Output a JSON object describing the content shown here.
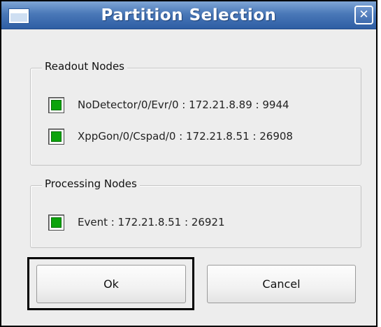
{
  "window": {
    "title": "Partition Selection",
    "close_label": "✕"
  },
  "readout_group": {
    "title": "Readout Nodes",
    "nodes": [
      {
        "label": "NoDetector/0/Evr/0 : 172.21.8.89 : 9944",
        "status_color": "#0ca30c"
      },
      {
        "label": "XppGon/0/Cspad/0 : 172.21.8.51 : 26908",
        "status_color": "#0ca30c"
      }
    ]
  },
  "processing_group": {
    "title": "Processing Nodes",
    "nodes": [
      {
        "label": "Event : 172.21.8.51 : 26921",
        "status_color": "#0ca30c"
      }
    ]
  },
  "buttons": {
    "ok_label": "Ok",
    "cancel_label": "Cancel"
  },
  "colors": {
    "titlebar": "#3d6aad",
    "status_ok": "#0ca30c",
    "dialog_bg": "#ededed"
  }
}
